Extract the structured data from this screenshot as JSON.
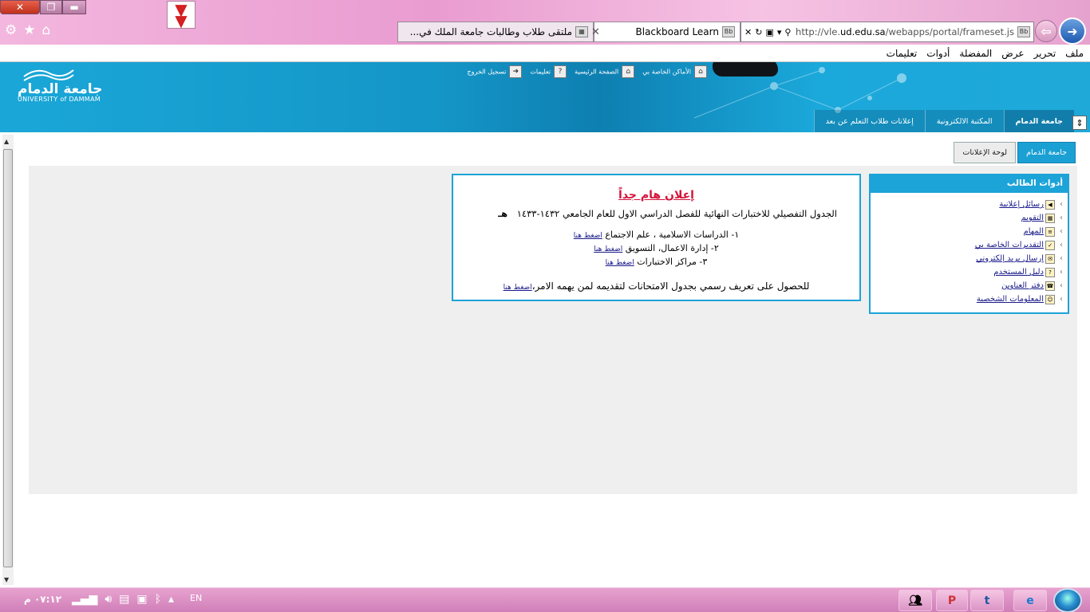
{
  "browser": {
    "window_controls": {
      "close": "✕",
      "restore": "❐",
      "minimize": "▬"
    },
    "tabs": [
      {
        "label": "ملتقى طلاب وطالبات جامعة الملك في...",
        "favicon": "forum-icon"
      },
      {
        "label": "Blackboard Learn",
        "favicon": "Bb"
      }
    ],
    "address": {
      "url_prefix": "http://vle.",
      "url_domain": "ud.edu.sa",
      "url_suffix": "/webapps/portal/frameset.js",
      "favicon": "Bb"
    },
    "menu": [
      "ملف",
      "تحرير",
      "عرض",
      "المفضلة",
      "أدوات",
      "تعليمات"
    ]
  },
  "header": {
    "logo_ar": "جامعة الدمام",
    "logo_en": "UNIVERSITY of DAMMAM",
    "top_links": [
      "الأماكن الخاصة بي",
      "الصفحة الرئيسية",
      "تعليمات",
      "تسجيل الخروج"
    ],
    "tabs": [
      "جامعة الدمام",
      "المكتبة الالكترونية",
      "إعلانات طلاب التعلم عن بعد"
    ]
  },
  "subtabs": [
    "جامعة الدمام",
    "لوحة الإعلانات"
  ],
  "student_tools": {
    "title": "أدوات الطالب",
    "items": [
      "رسائل إعلانية",
      "التقويم",
      "المهام",
      "التقديرات الخاصة بي",
      "إرسال بريد إلكتروني",
      "دليل المستخدم",
      "دفتر العناوين",
      "المعلومات الشخصية"
    ]
  },
  "announcement": {
    "title": "إعلان هام جداً",
    "line1": "الجدول التفصيلي للاختبارات النهائية للفصل الدراسي الاول للعام الجامعي ١٤٣٢-١٤٣٣",
    "line1_suffix": "هـ",
    "items": [
      {
        "text": "١- الدراسات الاسلامية ، علم الاجتماع",
        "link": "اضغط هنا"
      },
      {
        "text": "٢- إدارة الاعمال، التسويق",
        "link": "اضغط هنا"
      },
      {
        "text": "٣- مراكز الاختبارات",
        "link": "اضغط هنا"
      }
    ],
    "footer_text": "للحصول على تعريف رسمي بجدول الامتحانات لتقديمه لمن يهمه الامر،",
    "footer_link": "اضغط هنا"
  },
  "taskbar": {
    "clock": "٠٧:١٢ م",
    "language": "EN"
  }
}
